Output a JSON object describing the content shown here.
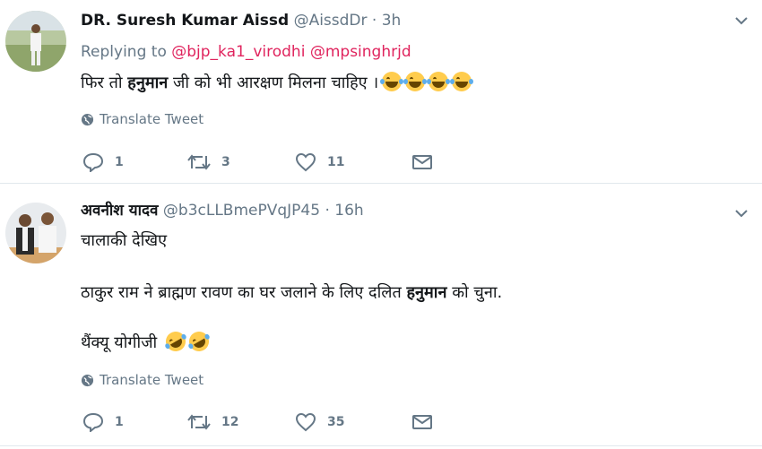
{
  "tweets": [
    {
      "name": "DR. Suresh Kumar Aissd",
      "handle": "@AissdDr",
      "dot": "·",
      "time": "3h",
      "replying_prefix": "Replying to",
      "replying_to_1": "@bjp_ka1_virodhi",
      "replying_to_2": "@mpsinghrjd",
      "text_pre": "फिर तो",
      "text_bold": "हनुमान",
      "text_post": "जी को भी आरक्षण मिलना चाहिए ।",
      "emoji": "face-with-tears-of-joy",
      "emoji_count": 4,
      "translate": "Translate Tweet",
      "replies": "1",
      "retweets": "3",
      "likes": "11"
    },
    {
      "name": "अवनीश यादव",
      "handle": "@b3cLLBmePVqJP45",
      "dot": "·",
      "time": "16h",
      "line1": "चालाकी देखिए",
      "line2_pre": "ठाकुर राम ने ब्राह्मण रावण का घर जलाने के लिए दलित",
      "line2_bold": "हनुमान",
      "line2_post": "को चुना.",
      "line3": "थैंक्यू योगीजी",
      "emoji": "rolling-on-floor-laughing",
      "emoji_count": 2,
      "translate": "Translate Tweet",
      "replies": "1",
      "retweets": "12",
      "likes": "35"
    }
  ],
  "colors": {
    "link": "#e0245e",
    "muted": "#657786",
    "text": "#14171a",
    "divider": "#e1e8ed"
  }
}
